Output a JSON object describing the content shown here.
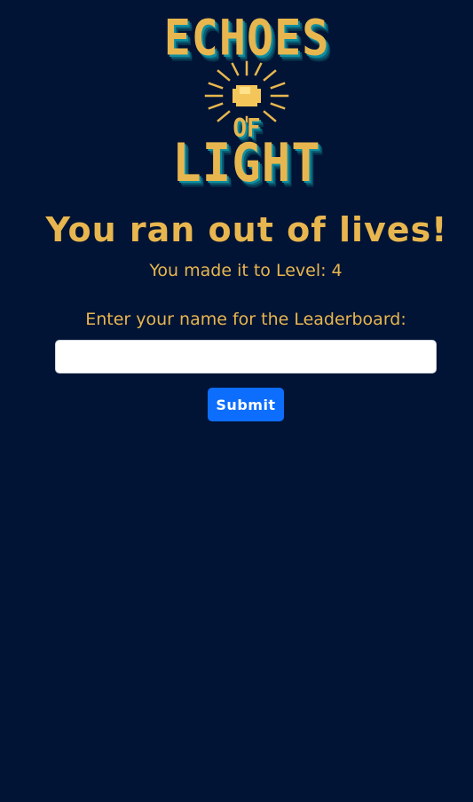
{
  "logo": {
    "line1": "ECHOES",
    "line2": "OF",
    "line3": "LIGHT"
  },
  "game_over": {
    "title": "You ran out of lives!",
    "level_text": "You made it to Level: 4"
  },
  "leaderboard_form": {
    "prompt": "Enter your name for the Leaderboard:",
    "name_value": "",
    "submit_label": "Submit"
  },
  "colors": {
    "background": "#011435",
    "accent_gold": "#e8b64f",
    "logo_teal": "#0e8fa0",
    "button_blue": "#0d6efd"
  }
}
